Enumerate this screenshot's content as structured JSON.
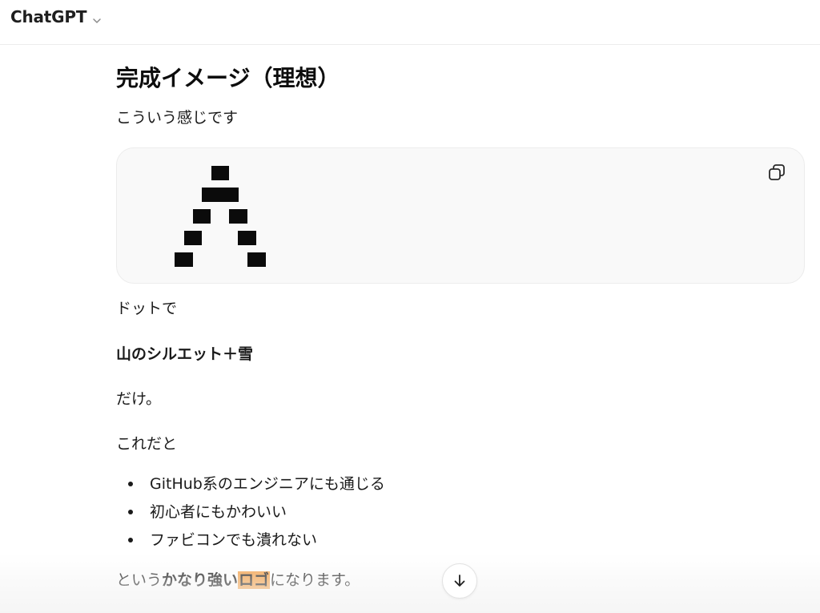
{
  "header": {
    "model_name": "ChatGPT",
    "dropdown_icon": "chevron-down-icon"
  },
  "message": {
    "heading": "完成イメージ（理想）",
    "intro": "こういう感じです",
    "code_block": {
      "copy_icon": "copy-icon",
      "art_description_pixels": "mountain dot art"
    },
    "line_dots": "ドットで",
    "line_silhouette": "山のシルエット＋雪",
    "line_only": "だけ。",
    "line_this": "これだと",
    "bullets": [
      "GitHub系のエンジニアにも通じる",
      "初心者にもかわいい",
      "ファビコンでも潰れない"
    ],
    "closing": {
      "prefix": "という",
      "bold": "かなり強い",
      "highlight": "ロゴ",
      "suffix": "になります。"
    }
  },
  "scroll_button_icon": "arrow-down-icon",
  "colors": {
    "highlight": "#f4a14a",
    "code_bg": "#f9f9f9",
    "text": "#0d0d0d"
  }
}
